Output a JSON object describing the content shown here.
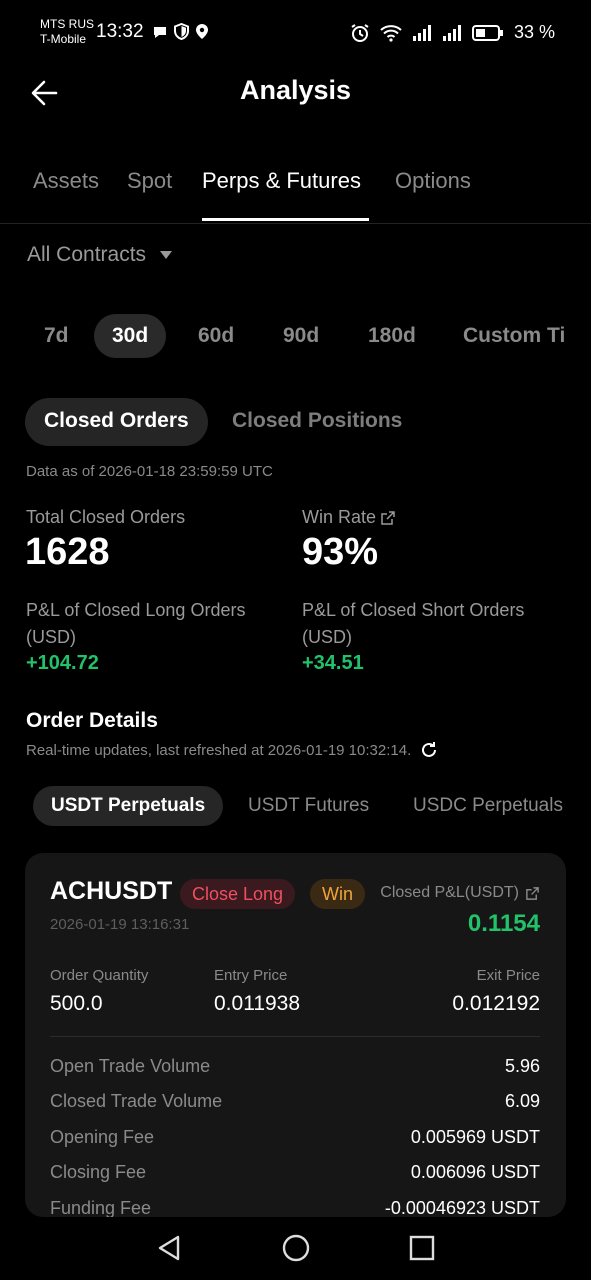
{
  "status": {
    "carrier1": "MTS RUS",
    "carrier2": "T-Mobile",
    "time": "13:32",
    "battery": "33 %"
  },
  "header": {
    "title": "Analysis"
  },
  "tabs": [
    {
      "label": "Assets"
    },
    {
      "label": "Spot"
    },
    {
      "label": "Perps & Futures"
    },
    {
      "label": "Options"
    }
  ],
  "contracts": {
    "label": "All Contracts"
  },
  "periods": [
    {
      "label": "7d"
    },
    {
      "label": "30d"
    },
    {
      "label": "60d"
    },
    {
      "label": "90d"
    },
    {
      "label": "180d"
    },
    {
      "label": "Custom Ti"
    }
  ],
  "order_types": [
    {
      "label": "Closed Orders"
    },
    {
      "label": "Closed Positions"
    }
  ],
  "as_of": "Data as of 2026-01-18 23:59:59 UTC",
  "stats": {
    "total_label": "Total Closed Orders",
    "total_value": "1628",
    "win_label": "Win Rate",
    "win_value": "93%",
    "long_label_1": "P&L of Closed Long Orders",
    "long_label_2": "(USD)",
    "long_value": "+104.72",
    "short_label_1": "P&L of Closed Short Orders",
    "short_label_2": "(USD)",
    "short_value": "+34.51"
  },
  "order_details": {
    "title": "Order Details",
    "refresh": "Real-time updates, last refreshed at 2026-01-19 10:32:14."
  },
  "subtabs": [
    {
      "label": "USDT Perpetuals"
    },
    {
      "label": "USDT Futures"
    },
    {
      "label": "USDC Perpetuals"
    }
  ],
  "card": {
    "symbol": "ACHUSDT",
    "side": "Close Long",
    "result": "Win",
    "pnl_label": "Closed P&L(USDT)",
    "pnl_value": "0.1154",
    "timestamp": "2026-01-19 13:16:31",
    "qty_label": "Order Quantity",
    "qty_value": "500.0",
    "entry_label": "Entry Price",
    "entry_value": "0.011938",
    "exit_label": "Exit Price",
    "exit_value": "0.012192",
    "rows": [
      {
        "k": "Open Trade Volume",
        "v": "5.96"
      },
      {
        "k": "Closed Trade Volume",
        "v": "6.09"
      },
      {
        "k": "Opening Fee",
        "v": "0.005969 USDT"
      },
      {
        "k": "Closing Fee",
        "v": "0.006096 USDT"
      },
      {
        "k": "Funding Fee",
        "v": "-0.00046923 USDT"
      }
    ]
  },
  "colors": {
    "positive": "#22c26b",
    "negative_badge": "#ef4f5e",
    "win_badge": "#f0a43a"
  }
}
